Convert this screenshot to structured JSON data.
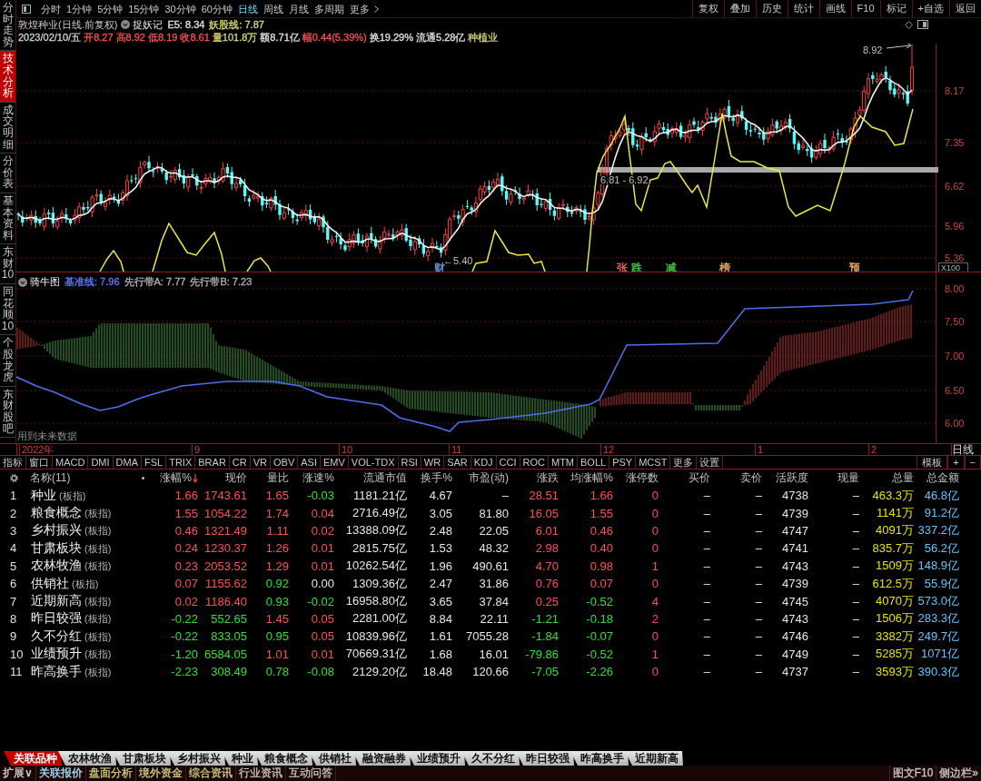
{
  "sidebar": {
    "tabs": [
      {
        "label": "分时走势",
        "selected": false
      },
      {
        "label": "技术分析",
        "selected": true
      },
      {
        "label": "成交明细",
        "selected": false
      },
      {
        "label": "分价表",
        "selected": false
      },
      {
        "label": "基本资料",
        "selected": false
      },
      {
        "label": "东财10",
        "selected": false
      },
      {
        "label": "同花顺10",
        "selected": false
      },
      {
        "label": "个股龙虎",
        "selected": false
      },
      {
        "label": "东财股吧",
        "selected": false
      }
    ]
  },
  "toolbar": {
    "periods": [
      {
        "label": "分时",
        "selected": false
      },
      {
        "label": "1分钟",
        "selected": false
      },
      {
        "label": "5分钟",
        "selected": false
      },
      {
        "label": "15分钟",
        "selected": false
      },
      {
        "label": "30分钟",
        "selected": false
      },
      {
        "label": "60分钟",
        "selected": false
      },
      {
        "label": "日线",
        "selected": true
      },
      {
        "label": "周线",
        "selected": false
      },
      {
        "label": "月线",
        "selected": false
      },
      {
        "label": "多周期",
        "selected": false
      },
      {
        "label": "更多",
        "selected": false
      }
    ],
    "buttons": [
      "复权",
      "叠加",
      "历史",
      "统计",
      "画线",
      "F10",
      "标记",
      "+自选",
      "返回"
    ]
  },
  "stock_header": {
    "title": "敦煌种业(日线.前复权)",
    "formula": "捉妖记",
    "values": [
      {
        "text": "E5: 8.34",
        "color": "#e0e0e0"
      },
      {
        "text": "妖股线: 7.87",
        "color": "#d8d870"
      }
    ]
  },
  "quote": [
    {
      "text": "2023/02/10/五",
      "color": "#d0d0d0"
    },
    {
      "text": "开8.27",
      "color": "#ff5050"
    },
    {
      "text": "高8.92",
      "color": "#ff5050"
    },
    {
      "text": "低8.19",
      "color": "#ff5050"
    },
    {
      "text": "收8.61",
      "color": "#ff5050"
    },
    {
      "text": "量101.8万",
      "color": "#d8d870"
    },
    {
      "text": "额8.71亿",
      "color": "#e0e0e0"
    },
    {
      "text": "幅0.44(5.39%)",
      "color": "#ff5050"
    },
    {
      "text": "换19.29%",
      "color": "#e0e0e0"
    },
    {
      "text": "流通5.28亿",
      "color": "#e0e0e0"
    },
    {
      "text": "种植业",
      "color": "#d8d870"
    }
  ],
  "main_chart": {
    "axis_labels": [
      "8.17",
      "7.35",
      "6.62",
      "5.96",
      "5.36"
    ],
    "scale": "X100",
    "high_label": "8.92",
    "low_label": "←5.40",
    "band_label": "6.81 - 6.92",
    "markers": [
      {
        "text": "财",
        "color": "#7090d0"
      },
      {
        "text": "张",
        "color": "#e06060"
      },
      {
        "text": "跌",
        "color": "#40c040"
      },
      {
        "text": "减",
        "color": "#40c040"
      },
      {
        "text": "榜",
        "color": "#e0a060"
      },
      {
        "text": "预",
        "color": "#e0a060"
      }
    ]
  },
  "indicator": {
    "name": "骑牛图",
    "values": [
      {
        "text": "基准线: 7.96",
        "color": "#5a7cff"
      },
      {
        "text": "先行带A: 7.77",
        "color": "#b0b0b0"
      },
      {
        "text": "先行带B: 7.23",
        "color": "#b0b0b0"
      }
    ],
    "axis_labels": [
      "8.00",
      "7.50",
      "7.00",
      "6.50",
      "6.00"
    ],
    "note": "用到未来数据"
  },
  "date_axis": {
    "labels": [
      "2022年",
      "9",
      "10",
      "11",
      "12",
      "1",
      "2"
    ],
    "period": "日线"
  },
  "indicator_tabs": {
    "tabs": [
      "指标",
      "窗口",
      "MACD",
      "DMI",
      "DMA",
      "FSL",
      "TRIX",
      "BRAR",
      "CR",
      "VR",
      "OBV",
      "ASI",
      "EMV",
      "VOL-TDX",
      "RSI",
      "WR",
      "SAR",
      "KDJ",
      "CCI",
      "ROC",
      "MTM",
      "BOLL",
      "PSY",
      "MCST",
      "更多",
      "设置"
    ],
    "buttons": [
      "模板",
      "+",
      "−"
    ]
  },
  "table": {
    "name_header": "名称(11)",
    "columns": [
      {
        "label": "涨幅%",
        "kind": "signed",
        "sorted": true
      },
      {
        "label": "现价",
        "kind": "signed",
        "sorted": false
      },
      {
        "label": "量比",
        "kind": "signed",
        "sorted": false
      },
      {
        "label": "涨速%",
        "kind": "signed",
        "sorted": false
      },
      {
        "label": "流通市值",
        "kind": "plain",
        "sorted": false
      },
      {
        "label": "换手%",
        "kind": "plain",
        "sorted": false
      },
      {
        "label": "市盈(动)",
        "kind": "plain",
        "sorted": false
      },
      {
        "label": "涨跌",
        "kind": "signed",
        "sorted": false
      },
      {
        "label": "均涨幅%",
        "kind": "signed",
        "sorted": false
      },
      {
        "label": "涨停数",
        "kind": "count",
        "sorted": false
      },
      {
        "label": "买价",
        "kind": "plain",
        "sorted": false
      },
      {
        "label": "卖价",
        "kind": "plain",
        "sorted": false
      },
      {
        "label": "活跃度",
        "kind": "plain",
        "sorted": false
      },
      {
        "label": "现量",
        "kind": "plain",
        "sorted": false
      },
      {
        "label": "总量",
        "kind": "volume",
        "sorted": false
      },
      {
        "label": "总金额",
        "kind": "amount",
        "sorted": false
      }
    ],
    "rows": [
      {
        "number": "1",
        "name": "种业",
        "tag": "(板指)",
        "cells": [
          {
            "text": "1.66",
            "color": "#ff5050"
          },
          {
            "text": "1743.61",
            "color": "#ff5050"
          },
          {
            "text": "1.65",
            "color": "#ff5050"
          },
          {
            "text": "-0.03",
            "color": "#30e030"
          },
          {
            "text": "1181.21亿"
          },
          {
            "text": "4.67"
          },
          {
            "text": "–"
          },
          {
            "text": "28.51",
            "color": "#ff5050"
          },
          {
            "text": "1.66",
            "color": "#ff5050"
          },
          {
            "text": "0"
          },
          {
            "text": "–"
          },
          {
            "text": "–"
          },
          {
            "text": "4738"
          },
          {
            "text": "–"
          },
          {
            "text": "463.3万"
          },
          {
            "text": "46.8亿"
          }
        ]
      },
      {
        "number": "2",
        "name": "粮食概念",
        "tag": "(板指)",
        "cells": [
          {
            "text": "1.55",
            "color": "#ff5050"
          },
          {
            "text": "1054.22",
            "color": "#ff5050"
          },
          {
            "text": "1.74",
            "color": "#ff5050"
          },
          {
            "text": "0.04",
            "color": "#ff5050"
          },
          {
            "text": "2716.49亿"
          },
          {
            "text": "3.05"
          },
          {
            "text": "81.80"
          },
          {
            "text": "16.05",
            "color": "#ff5050"
          },
          {
            "text": "1.55",
            "color": "#ff5050"
          },
          {
            "text": "0"
          },
          {
            "text": "–"
          },
          {
            "text": "–"
          },
          {
            "text": "4739"
          },
          {
            "text": "–"
          },
          {
            "text": "1141万"
          },
          {
            "text": "91.2亿"
          }
        ]
      },
      {
        "number": "3",
        "name": "乡村振兴",
        "tag": "(板指)",
        "cells": [
          {
            "text": "0.46",
            "color": "#ff5050"
          },
          {
            "text": "1321.49",
            "color": "#ff5050"
          },
          {
            "text": "1.11",
            "color": "#ff5050"
          },
          {
            "text": "0.02",
            "color": "#ff5050"
          },
          {
            "text": "13388.09亿"
          },
          {
            "text": "2.48"
          },
          {
            "text": "22.05"
          },
          {
            "text": "6.01",
            "color": "#ff5050"
          },
          {
            "text": "0.46",
            "color": "#ff5050"
          },
          {
            "text": "0"
          },
          {
            "text": "–"
          },
          {
            "text": "–"
          },
          {
            "text": "4747"
          },
          {
            "text": "–"
          },
          {
            "text": "4091万"
          },
          {
            "text": "337.2亿"
          }
        ]
      },
      {
        "number": "4",
        "name": "甘肃板块",
        "tag": "(板指)",
        "cells": [
          {
            "text": "0.24",
            "color": "#ff5050"
          },
          {
            "text": "1230.37",
            "color": "#ff5050"
          },
          {
            "text": "1.26",
            "color": "#ff5050"
          },
          {
            "text": "0.01",
            "color": "#ff5050"
          },
          {
            "text": "2815.75亿"
          },
          {
            "text": "1.53"
          },
          {
            "text": "48.32"
          },
          {
            "text": "2.98",
            "color": "#ff5050"
          },
          {
            "text": "0.40",
            "color": "#ff5050"
          },
          {
            "text": "0"
          },
          {
            "text": "–"
          },
          {
            "text": "–"
          },
          {
            "text": "4741"
          },
          {
            "text": "–"
          },
          {
            "text": "835.7万"
          },
          {
            "text": "56.2亿"
          }
        ]
      },
      {
        "number": "5",
        "name": "农林牧渔",
        "tag": "(板指)",
        "cells": [
          {
            "text": "0.23",
            "color": "#ff5050"
          },
          {
            "text": "2053.52",
            "color": "#ff5050"
          },
          {
            "text": "1.29",
            "color": "#ff5050"
          },
          {
            "text": "0.01",
            "color": "#ff5050"
          },
          {
            "text": "10262.54亿"
          },
          {
            "text": "1.96"
          },
          {
            "text": "490.61"
          },
          {
            "text": "4.70",
            "color": "#ff5050"
          },
          {
            "text": "0.98",
            "color": "#ff5050"
          },
          {
            "text": "1"
          },
          {
            "text": "–"
          },
          {
            "text": "–"
          },
          {
            "text": "4743"
          },
          {
            "text": "–"
          },
          {
            "text": "1509万"
          },
          {
            "text": "148.9亿"
          }
        ]
      },
      {
        "number": "6",
        "name": "供销社",
        "tag": "(板指)",
        "cells": [
          {
            "text": "0.07",
            "color": "#ff5050"
          },
          {
            "text": "1155.62",
            "color": "#ff5050"
          },
          {
            "text": "0.92",
            "color": "#30e030"
          },
          {
            "text": "0.00",
            "color": "#e6e6e6"
          },
          {
            "text": "1309.36亿"
          },
          {
            "text": "2.47"
          },
          {
            "text": "31.86"
          },
          {
            "text": "0.76",
            "color": "#ff5050"
          },
          {
            "text": "0.07",
            "color": "#ff5050"
          },
          {
            "text": "0"
          },
          {
            "text": "–"
          },
          {
            "text": "–"
          },
          {
            "text": "4739"
          },
          {
            "text": "–"
          },
          {
            "text": "612.5万"
          },
          {
            "text": "55.9亿"
          }
        ]
      },
      {
        "number": "7",
        "name": "近期新高",
        "tag": "(板指)",
        "cells": [
          {
            "text": "0.02",
            "color": "#ff5050"
          },
          {
            "text": "1186.40",
            "color": "#ff5050"
          },
          {
            "text": "0.93",
            "color": "#30e030"
          },
          {
            "text": "-0.02",
            "color": "#30e030"
          },
          {
            "text": "16958.80亿"
          },
          {
            "text": "3.65"
          },
          {
            "text": "37.84"
          },
          {
            "text": "0.25",
            "color": "#ff5050"
          },
          {
            "text": "-0.52",
            "color": "#30e030"
          },
          {
            "text": "4"
          },
          {
            "text": "–"
          },
          {
            "text": "–"
          },
          {
            "text": "4745"
          },
          {
            "text": "–"
          },
          {
            "text": "4070万"
          },
          {
            "text": "573.0亿"
          }
        ]
      },
      {
        "number": "8",
        "name": "昨日较强",
        "tag": "(板指)",
        "cells": [
          {
            "text": "-0.22",
            "color": "#30e030"
          },
          {
            "text": "552.65",
            "color": "#30e030"
          },
          {
            "text": "1.45",
            "color": "#ff5050"
          },
          {
            "text": "0.05",
            "color": "#ff5050"
          },
          {
            "text": "2281.00亿"
          },
          {
            "text": "8.84"
          },
          {
            "text": "22.11"
          },
          {
            "text": "-1.21",
            "color": "#30e030"
          },
          {
            "text": "-0.18",
            "color": "#30e030"
          },
          {
            "text": "2"
          },
          {
            "text": "–"
          },
          {
            "text": "–"
          },
          {
            "text": "4743"
          },
          {
            "text": "–"
          },
          {
            "text": "1506万"
          },
          {
            "text": "283.3亿"
          }
        ]
      },
      {
        "number": "9",
        "name": "久不分红",
        "tag": "(板指)",
        "cells": [
          {
            "text": "-0.22",
            "color": "#30e030"
          },
          {
            "text": "833.05",
            "color": "#30e030"
          },
          {
            "text": "0.95",
            "color": "#30e030"
          },
          {
            "text": "0.05",
            "color": "#ff5050"
          },
          {
            "text": "10839.96亿"
          },
          {
            "text": "1.61"
          },
          {
            "text": "7055.28"
          },
          {
            "text": "-1.84",
            "color": "#30e030"
          },
          {
            "text": "-0.07",
            "color": "#30e030"
          },
          {
            "text": "0"
          },
          {
            "text": "–"
          },
          {
            "text": "–"
          },
          {
            "text": "4746"
          },
          {
            "text": "–"
          },
          {
            "text": "3382万"
          },
          {
            "text": "249.7亿"
          }
        ]
      },
      {
        "number": "10",
        "name": "业绩预升",
        "tag": "(板指)",
        "cells": [
          {
            "text": "-1.20",
            "color": "#30e030"
          },
          {
            "text": "6584.05",
            "color": "#30e030"
          },
          {
            "text": "1.01",
            "color": "#ff5050"
          },
          {
            "text": "0.01",
            "color": "#ff5050"
          },
          {
            "text": "70669.31亿"
          },
          {
            "text": "1.68"
          },
          {
            "text": "16.01"
          },
          {
            "text": "-79.86",
            "color": "#30e030"
          },
          {
            "text": "-0.52",
            "color": "#30e030"
          },
          {
            "text": "1"
          },
          {
            "text": "–"
          },
          {
            "text": "–"
          },
          {
            "text": "4749"
          },
          {
            "text": "–"
          },
          {
            "text": "5285万"
          },
          {
            "text": "1071亿"
          }
        ]
      },
      {
        "number": "11",
        "name": "昨高换手",
        "tag": "(板指)",
        "cells": [
          {
            "text": "-2.23",
            "color": "#30e030"
          },
          {
            "text": "308.49",
            "color": "#30e030"
          },
          {
            "text": "0.78",
            "color": "#30e030"
          },
          {
            "text": "-0.08",
            "color": "#30e030"
          },
          {
            "text": "2129.20亿"
          },
          {
            "text": "18.48"
          },
          {
            "text": "120.66"
          },
          {
            "text": "-7.05",
            "color": "#30e030"
          },
          {
            "text": "-2.26",
            "color": "#30e030"
          },
          {
            "text": "0"
          },
          {
            "text": "–"
          },
          {
            "text": "–"
          },
          {
            "text": "4737"
          },
          {
            "text": "–"
          },
          {
            "text": "3593万"
          },
          {
            "text": "390.3亿"
          }
        ]
      }
    ]
  },
  "related_tabs": [
    {
      "label": "关联品种",
      "selected": true
    },
    {
      "label": "农林牧渔",
      "selected": false
    },
    {
      "label": "甘肃板块",
      "selected": false
    },
    {
      "label": "乡村振兴",
      "selected": false
    },
    {
      "label": "种业",
      "selected": false
    },
    {
      "label": "粮食概念",
      "selected": false
    },
    {
      "label": "供销社",
      "selected": false
    },
    {
      "label": "融资融券",
      "selected": false
    },
    {
      "label": "业绩预升",
      "selected": false
    },
    {
      "label": "久不分红",
      "selected": false
    },
    {
      "label": "昨日较强",
      "selected": false
    },
    {
      "label": "昨高换手",
      "selected": false
    },
    {
      "label": "近期新高",
      "selected": false
    }
  ],
  "bottom_bar": {
    "items": [
      {
        "text": "扩展∨",
        "color": "#d0d0d0"
      },
      {
        "text": "关联报价",
        "color": "#a8e0ff"
      },
      {
        "text": "盘面分析",
        "color": "#d0d080"
      },
      {
        "text": "境外资金",
        "color": "#d0d080"
      },
      {
        "text": "综合资讯",
        "color": "#d0d080"
      },
      {
        "text": "行业资讯",
        "color": "#c8c8b4"
      },
      {
        "text": "互动问答",
        "color": "#c8c8b4"
      }
    ],
    "right_items": [
      "图文F10",
      "侧边栏»"
    ]
  }
}
